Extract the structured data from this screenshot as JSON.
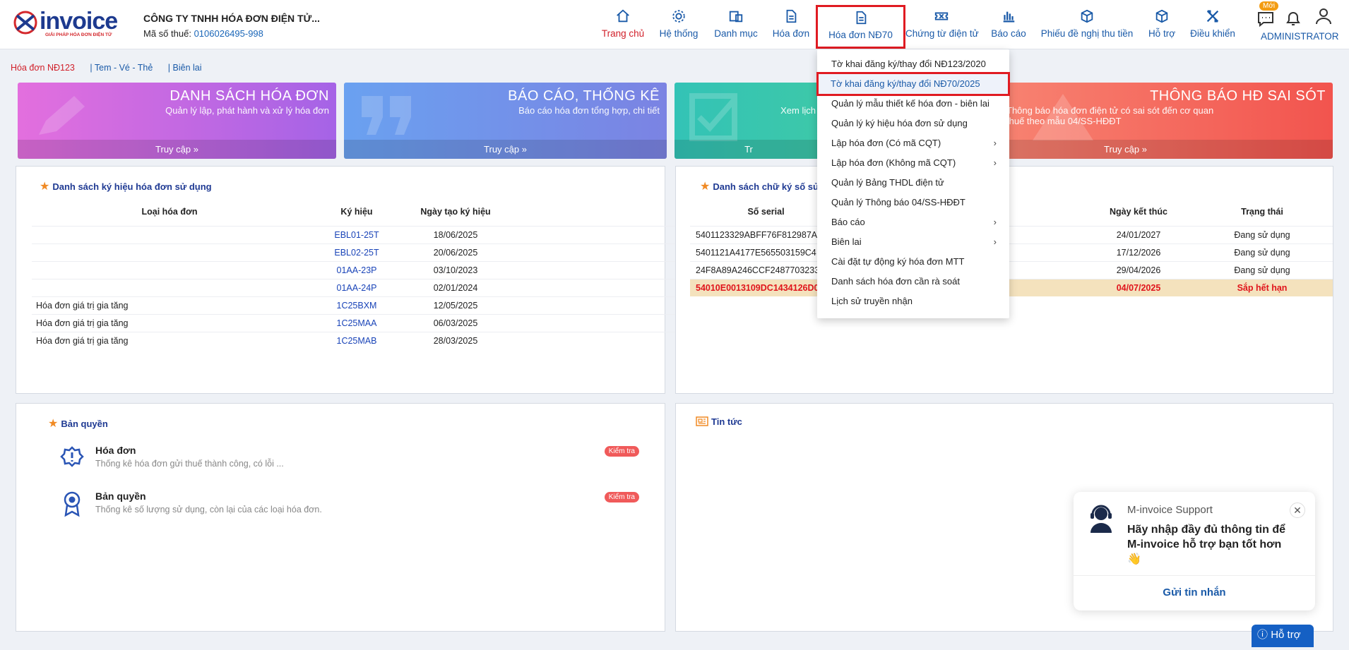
{
  "company": {
    "name": "CÔNG TY TNHH HÓA ĐƠN ĐIỆN TỬ...",
    "tax_label": "Mã số thuế:",
    "tax_code": "0106026495-998"
  },
  "logo": {
    "word": "invoice",
    "tagline": "GIẢI PHÁP HÓA ĐƠN ĐIỆN TỬ"
  },
  "nav": [
    {
      "label": "Trang chủ",
      "icon": "home-icon"
    },
    {
      "label": "Hệ thống",
      "icon": "gear-icon"
    },
    {
      "label": "Danh mục",
      "icon": "catalog-icon"
    },
    {
      "label": "Hóa đơn",
      "icon": "document-icon"
    },
    {
      "label": "Hóa đơn NĐ70",
      "icon": "document-icon"
    },
    {
      "label": "Chứng từ điện tử",
      "icon": "ticket-icon"
    },
    {
      "label": "Báo cáo",
      "icon": "bar-chart-icon"
    },
    {
      "label": "Phiếu đề nghị thu tiền",
      "icon": "box-icon"
    },
    {
      "label": "Hỗ trợ",
      "icon": "cube-icon"
    },
    {
      "label": "Điều khiển",
      "icon": "tools-icon"
    }
  ],
  "top_right": {
    "new_badge": "Mới",
    "user": "ADMINISTRATOR"
  },
  "subnav": [
    "Hóa đơn NĐ123",
    "| Tem - Vé - Thẻ",
    "| Biên lai"
  ],
  "banners": [
    {
      "title": "DANH SÁCH HÓA ĐƠN",
      "desc": "Quản lý lập, phát hành và xử lý hóa đơn",
      "link": "Truy cập  »"
    },
    {
      "title": "BÁO CÁO, THỐNG KÊ",
      "desc": "Báo cáo hóa đơn tổng hợp, chi tiết",
      "link": "Truy cập  »"
    },
    {
      "title": "",
      "desc": "Xem lịch",
      "link": "Tr"
    },
    {
      "title": "THÔNG BÁO HĐ SAI SÓT",
      "desc": "Thông báo hóa đơn điện tử có sai sót đến cơ quan thuế theo mẫu 04/SS-HĐĐT",
      "link": "Truy cập  »"
    }
  ],
  "symbols_panel": {
    "title": "Danh sách ký hiệu hóa đơn sử dụng",
    "headers": [
      "Loại hóa đơn",
      "Ký hiệu",
      "Ngày tạo ký hiệu"
    ],
    "rows": [
      {
        "type": "",
        "code": "EBL01-25T",
        "date": "18/06/2025"
      },
      {
        "type": "",
        "code": "EBL02-25T",
        "date": "20/06/2025"
      },
      {
        "type": "",
        "code": "01AA-23P",
        "date": "03/10/2023"
      },
      {
        "type": "",
        "code": "01AA-24P",
        "date": "02/01/2024"
      },
      {
        "type": "Hóa đơn giá trị gia tăng",
        "code": "1C25BXM",
        "date": "12/05/2025"
      },
      {
        "type": "Hóa đơn giá trị gia tăng",
        "code": "1C25MAA",
        "date": "06/03/2025"
      },
      {
        "type": "Hóa đơn giá trị gia tăng",
        "code": "1C25MAB",
        "date": "28/03/2025"
      }
    ]
  },
  "signature_panel": {
    "title": "Danh sách chữ ký số sử",
    "headers": [
      "Số serial",
      "Ngày kết thúc",
      "Trạng thái"
    ],
    "rows": [
      {
        "serial": "5401123329ABFF76F812987A",
        "end": "24/01/2027",
        "status": "Đang sử dụng",
        "warn": false
      },
      {
        "serial": "5401121A4177E565503159C4",
        "end": "17/12/2026",
        "status": "Đang sử dụng",
        "warn": false
      },
      {
        "serial": "24F8A89A246CCF2487703233",
        "end": "29/04/2026",
        "status": "Đang sử dụng",
        "warn": false
      },
      {
        "serial": "54010E0013109DC1434126D0",
        "end": "04/07/2025",
        "status": "Sắp hết hạn",
        "warn": true
      }
    ]
  },
  "license_panel": {
    "title": "Bản quyền",
    "items": [
      {
        "title": "Hóa đơn",
        "desc": "Thống kê hóa đơn gửi thuế thành công, có lỗi ...",
        "badge": "Kiểm tra"
      },
      {
        "title": "Bản quyền",
        "desc": "Thống kê số lượng sử dụng, còn lại của các loại hóa đơn.",
        "badge": "Kiểm tra"
      }
    ]
  },
  "news_panel": {
    "title": "Tin tức"
  },
  "dropdown": [
    {
      "label": "Tờ khai đăng ký/thay đổi NĐ123/2020",
      "sub": false
    },
    {
      "label": "Tờ khai đăng ký/thay đổi NĐ70/2025",
      "sub": false,
      "selected": true
    },
    {
      "label": "Quản lý mẫu thiết kế hóa đơn - biên lai",
      "sub": false
    },
    {
      "label": "Quản lý ký hiệu hóa đơn sử dụng",
      "sub": false
    },
    {
      "label": "Lập hóa đơn (Có mã CQT)",
      "sub": true
    },
    {
      "label": "Lập hóa đơn (Không mã CQT)",
      "sub": true
    },
    {
      "label": "Quản lý Bảng THDL điện tử",
      "sub": false
    },
    {
      "label": "Quản lý Thông báo 04/SS-HĐĐT",
      "sub": false
    },
    {
      "label": "Báo cáo",
      "sub": true
    },
    {
      "label": "Biên lai",
      "sub": true
    },
    {
      "label": "Cài đặt tự động ký hóa đơn MTT",
      "sub": false
    },
    {
      "label": "Danh sách hóa đơn cần rà soát",
      "sub": false
    },
    {
      "label": "Lịch sử truyền nhận",
      "sub": false
    }
  ],
  "chat": {
    "who": "M-invoice Support",
    "message": "Hãy nhập đầy đủ thông tin để M-invoice hỗ trợ bạn tốt hơn 👋",
    "send": "Gửi tin nhắn",
    "close": "✕"
  },
  "help_button": "Hỗ trợ",
  "colors": {
    "brand": "#1d3a8f",
    "accent_red": "#e01b22",
    "nav_blue": "#1a5aa8",
    "warn_row": "#f4e2bd"
  }
}
